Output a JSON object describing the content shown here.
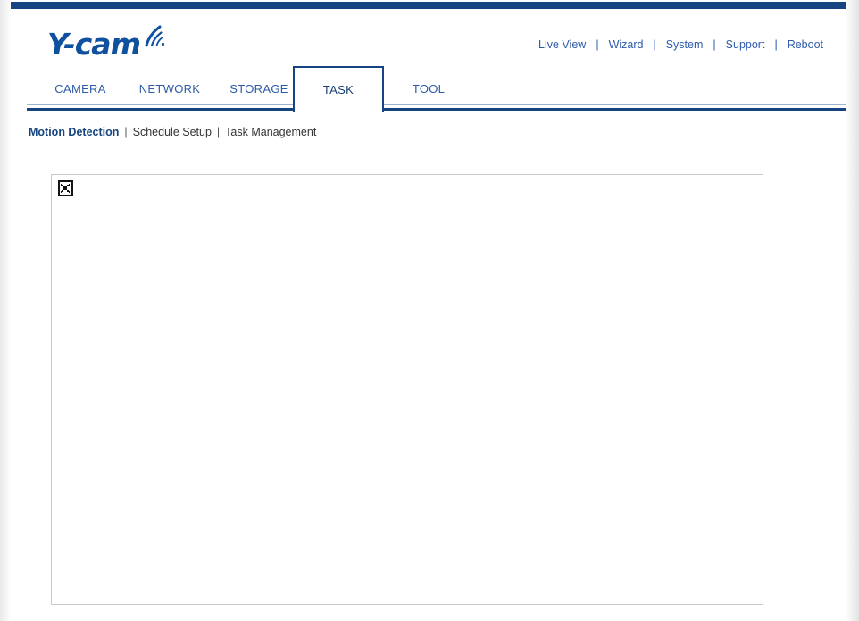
{
  "brand": {
    "logo_text": "Y-cam",
    "logo_icon": "wifi-signal-icon",
    "logo_color": "#10519f"
  },
  "theme": {
    "navy": "#154480",
    "link_blue": "#2e5ba8",
    "active_sub_blue": "#16447f",
    "body_text": "#333333",
    "panel_border": "#c9c9c9",
    "page_background": "#ffffff"
  },
  "utility_nav": {
    "separator": "|",
    "items": [
      {
        "label": "Live View"
      },
      {
        "label": "Wizard"
      },
      {
        "label": "System"
      },
      {
        "label": "Support"
      },
      {
        "label": "Reboot"
      }
    ]
  },
  "tabs": {
    "active": "TASK",
    "items": [
      {
        "label": "CAMERA",
        "active": false
      },
      {
        "label": "NETWORK",
        "active": false
      },
      {
        "label": "STORAGE",
        "active": false
      },
      {
        "label": "TASK",
        "active": true
      },
      {
        "label": "TOOL",
        "active": false
      }
    ]
  },
  "subnav": {
    "separator": "|",
    "items": [
      {
        "label": "Motion Detection",
        "active": true
      },
      {
        "label": "Schedule Setup",
        "active": false
      },
      {
        "label": "Task Management",
        "active": false
      }
    ]
  },
  "content": {
    "placeholder_icon": "broken-image-icon",
    "placeholder_alt": ""
  }
}
